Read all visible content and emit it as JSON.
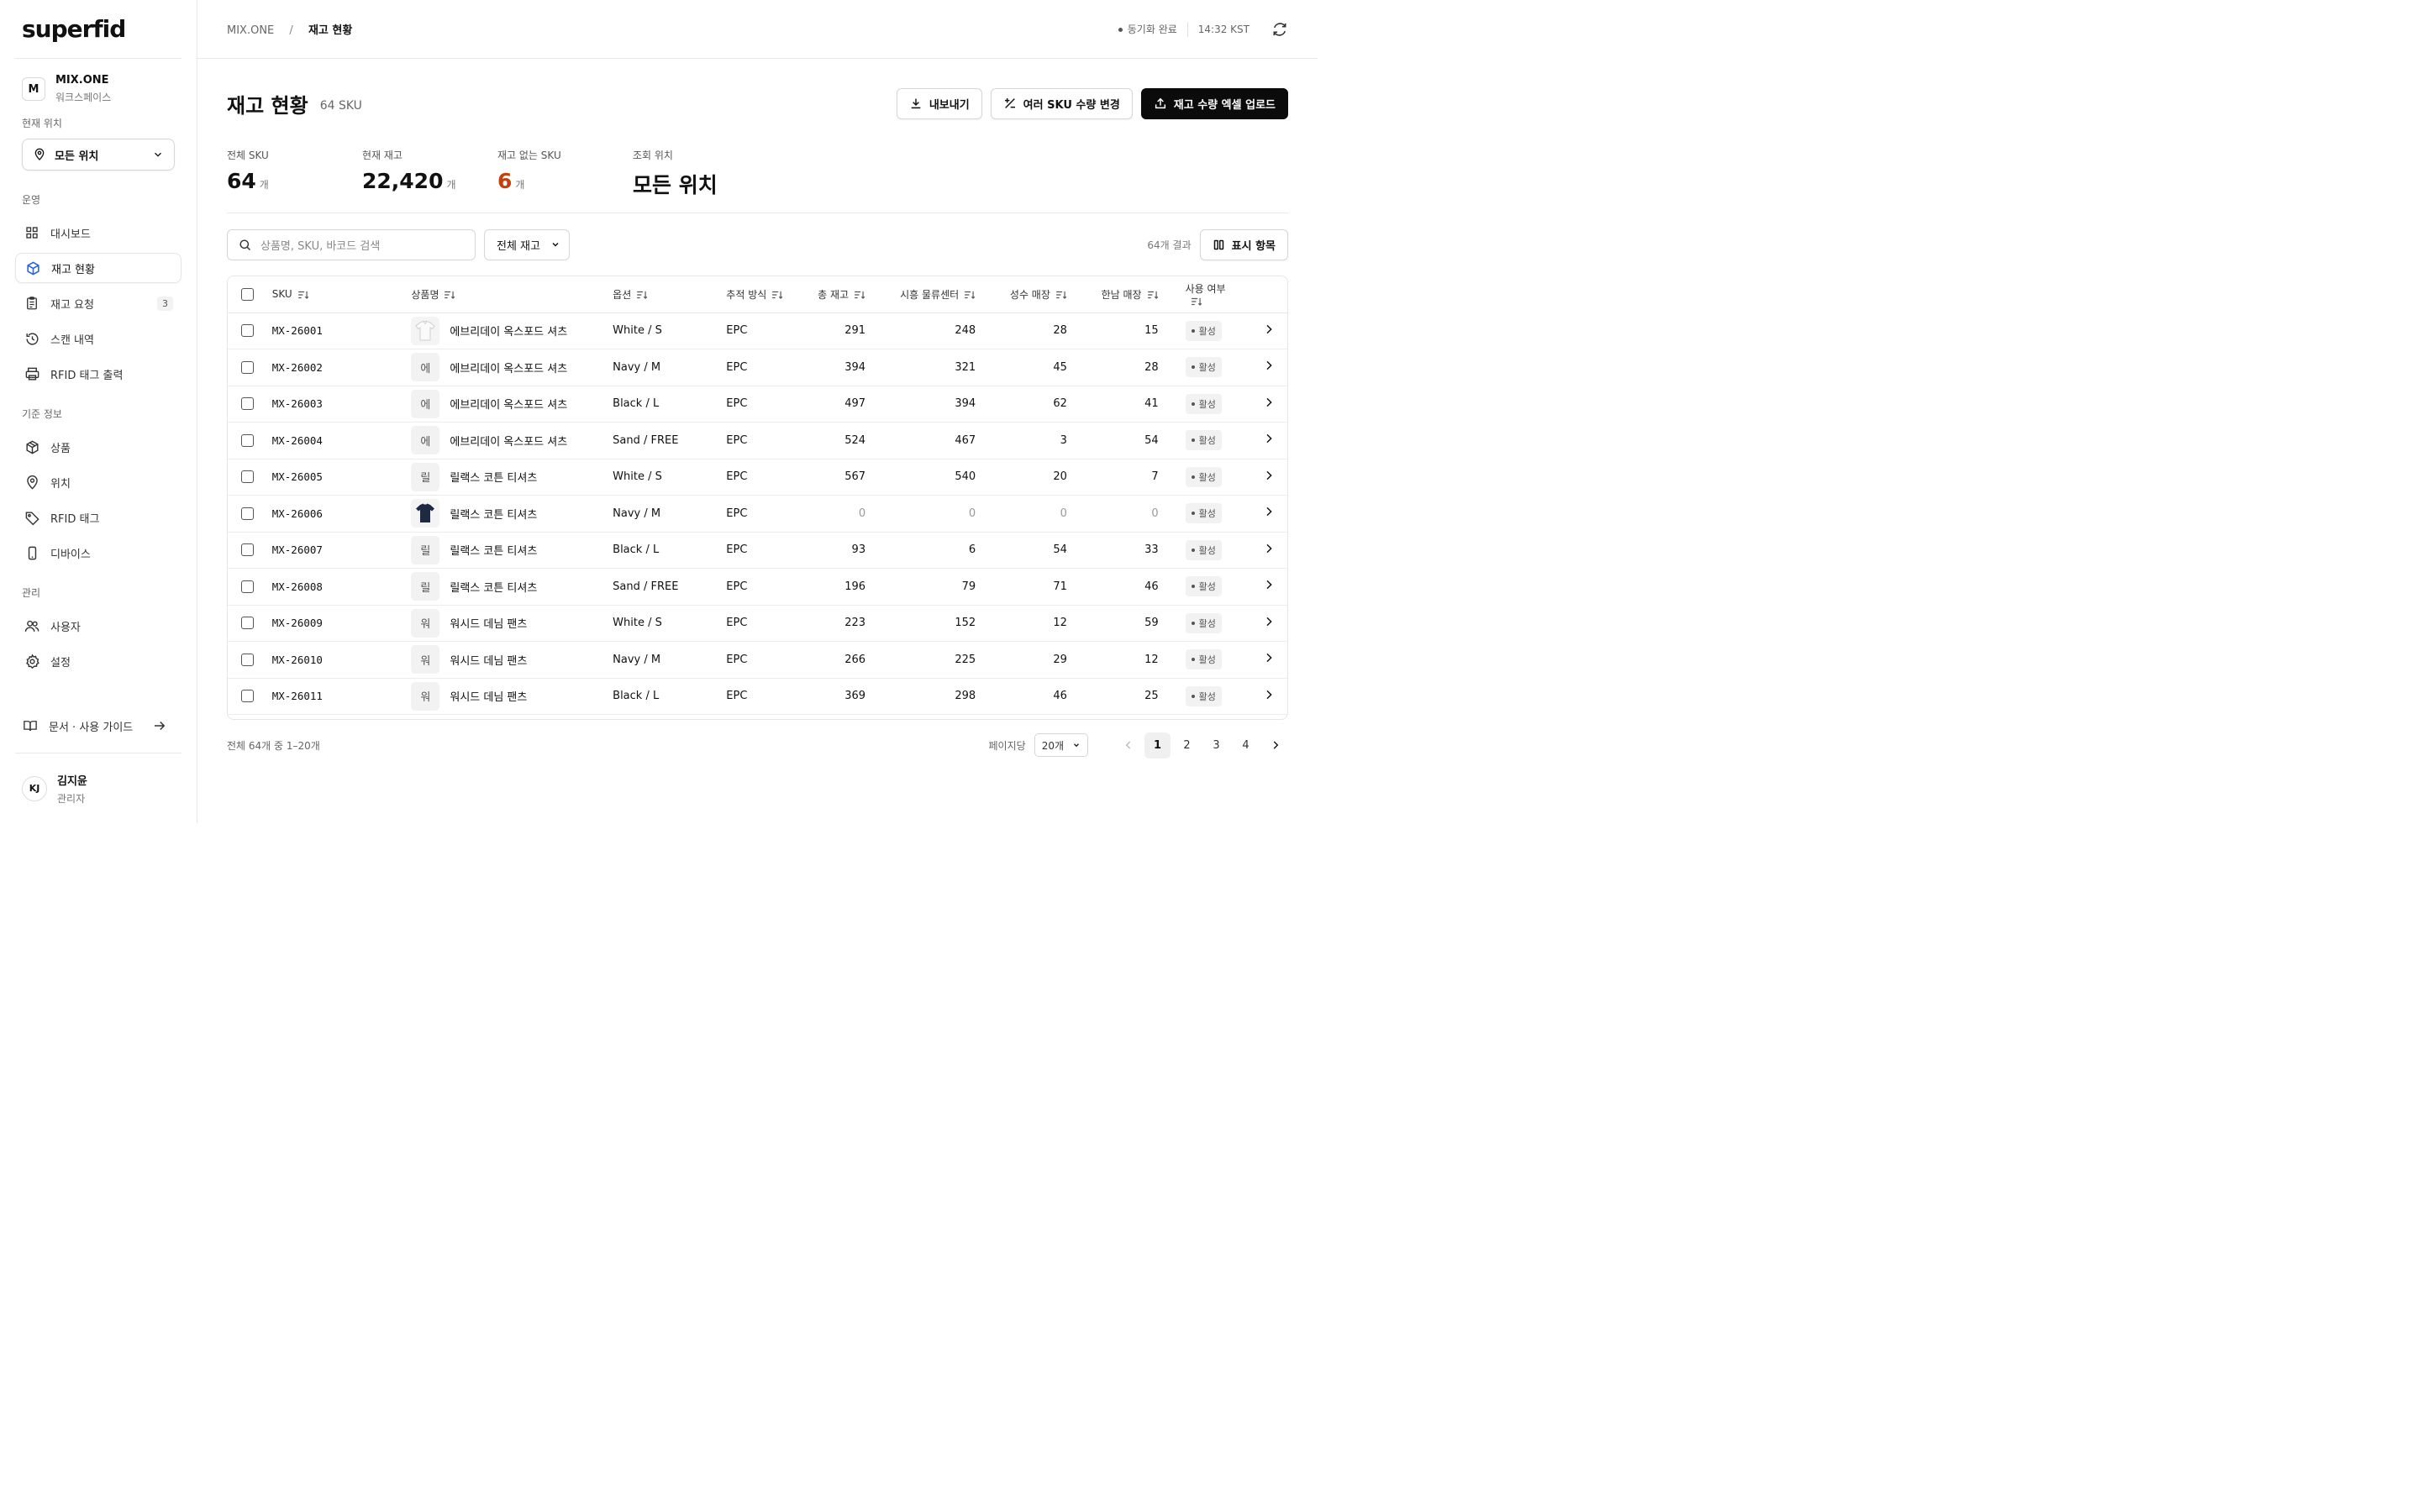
{
  "brand": {
    "logo": "superfid"
  },
  "workspace": {
    "avatar": "M",
    "name": "MIX.ONE",
    "sub": "워크스페이스"
  },
  "location": {
    "label": "현재 위치",
    "value": "모든 위치"
  },
  "nav": {
    "operation_label": "운영",
    "operation": [
      {
        "label": "대시보드",
        "icon": "grid-icon"
      },
      {
        "label": "재고 현황",
        "icon": "box-icon",
        "active": true
      },
      {
        "label": "재고 요청",
        "icon": "clipboard-icon",
        "badge": "3"
      },
      {
        "label": "스캔 내역",
        "icon": "history-icon"
      },
      {
        "label": "RFID 태그 출력",
        "icon": "printer-icon"
      }
    ],
    "master_label": "기준 정보",
    "master": [
      {
        "label": "상품",
        "icon": "package-icon"
      },
      {
        "label": "위치",
        "icon": "map-pin-icon"
      },
      {
        "label": "RFID 태그",
        "icon": "tag-icon"
      },
      {
        "label": "디바이스",
        "icon": "device-icon"
      }
    ],
    "admin_label": "관리",
    "admin": [
      {
        "label": "사용자",
        "icon": "users-icon"
      },
      {
        "label": "설정",
        "icon": "gear-icon"
      }
    ]
  },
  "guide": {
    "label": "문서 · 사용 가이드"
  },
  "user": {
    "initials": "KJ",
    "name": "김지윤",
    "role": "관리자"
  },
  "topbar": {
    "crumb_root": "MIX.ONE",
    "crumb_sep": "/",
    "crumb_current": "재고 현황",
    "sync_status": "동기화 완료",
    "time": "14:32 KST"
  },
  "page": {
    "title": "재고 현황",
    "subtitle": "64 SKU",
    "export_label": "내보내기",
    "bulk_label": "여러 SKU 수량 변경",
    "upload_label": "재고 수량 엑셀 업로드"
  },
  "stats": [
    {
      "label": "전체 SKU",
      "value": "64",
      "unit": "개"
    },
    {
      "label": "현재 재고",
      "value": "22,420",
      "unit": "개"
    },
    {
      "label": "재고 없는 SKU",
      "value": "6",
      "unit": "개",
      "danger": true
    },
    {
      "label": "조회 위치",
      "value": "모든 위치",
      "unit": ""
    }
  ],
  "toolbar": {
    "search_placeholder": "상품명, SKU, 바코드 검색",
    "filter_value": "전체 재고",
    "result_count": "64개 결과",
    "columns_label": "표시 항목"
  },
  "table": {
    "headers": [
      "SKU",
      "상품명",
      "옵션",
      "추적 방식",
      "총 재고",
      "시흥 물류센터",
      "성수 매장",
      "한남 매장",
      "사용 여부"
    ],
    "rows": [
      {
        "sku": "MX-26001",
        "thumb": "shirt-white",
        "name": "에브리데이 옥스포드 셔츠",
        "option": "White / S",
        "track": "EPC",
        "total": "291",
        "siheung": "248",
        "seongsu": "28",
        "hannam": "15",
        "status": "활성"
      },
      {
        "sku": "MX-26002",
        "thumb": "에",
        "name": "에브리데이 옥스포드 셔츠",
        "option": "Navy / M",
        "track": "EPC",
        "total": "394",
        "siheung": "321",
        "seongsu": "45",
        "hannam": "28",
        "status": "활성"
      },
      {
        "sku": "MX-26003",
        "thumb": "에",
        "name": "에브리데이 옥스포드 셔츠",
        "option": "Black / L",
        "track": "EPC",
        "total": "497",
        "siheung": "394",
        "seongsu": "62",
        "hannam": "41",
        "status": "활성"
      },
      {
        "sku": "MX-26004",
        "thumb": "에",
        "name": "에브리데이 옥스포드 셔츠",
        "option": "Sand / FREE",
        "track": "EPC",
        "total": "524",
        "siheung": "467",
        "seongsu": "3",
        "hannam": "54",
        "status": "활성"
      },
      {
        "sku": "MX-26005",
        "thumb": "릴",
        "name": "릴랙스 코튼 티셔츠",
        "option": "White / S",
        "track": "EPC",
        "total": "567",
        "siheung": "540",
        "seongsu": "20",
        "hannam": "7",
        "status": "활성"
      },
      {
        "sku": "MX-26006",
        "thumb": "tshirt-navy",
        "name": "릴랙스 코튼 티셔츠",
        "option": "Navy / M",
        "track": "EPC",
        "total": "0",
        "siheung": "0",
        "seongsu": "0",
        "hannam": "0",
        "status": "활성"
      },
      {
        "sku": "MX-26007",
        "thumb": "릴",
        "name": "릴랙스 코튼 티셔츠",
        "option": "Black / L",
        "track": "EPC",
        "total": "93",
        "siheung": "6",
        "seongsu": "54",
        "hannam": "33",
        "status": "활성"
      },
      {
        "sku": "MX-26008",
        "thumb": "릴",
        "name": "릴랙스 코튼 티셔츠",
        "option": "Sand / FREE",
        "track": "EPC",
        "total": "196",
        "siheung": "79",
        "seongsu": "71",
        "hannam": "46",
        "status": "활성"
      },
      {
        "sku": "MX-26009",
        "thumb": "워",
        "name": "워시드 데님 팬츠",
        "option": "White / S",
        "track": "EPC",
        "total": "223",
        "siheung": "152",
        "seongsu": "12",
        "hannam": "59",
        "status": "활성"
      },
      {
        "sku": "MX-26010",
        "thumb": "워",
        "name": "워시드 데님 팬츠",
        "option": "Navy / M",
        "track": "EPC",
        "total": "266",
        "siheung": "225",
        "seongsu": "29",
        "hannam": "12",
        "status": "활성"
      },
      {
        "sku": "MX-26011",
        "thumb": "워",
        "name": "워시드 데님 팬츠",
        "option": "Black / L",
        "track": "EPC",
        "total": "369",
        "siheung": "298",
        "seongsu": "46",
        "hannam": "25",
        "status": "활성"
      }
    ]
  },
  "footer": {
    "summary": "전체 64개 중 1–20개",
    "per_page_label": "페이지당",
    "per_page_value": "20개",
    "pages": [
      "1",
      "2",
      "3",
      "4"
    ],
    "current_page": "1"
  },
  "colors": {
    "primary": "#0b0b0b",
    "danger": "#c2410c",
    "border": "#e6e6e6"
  }
}
